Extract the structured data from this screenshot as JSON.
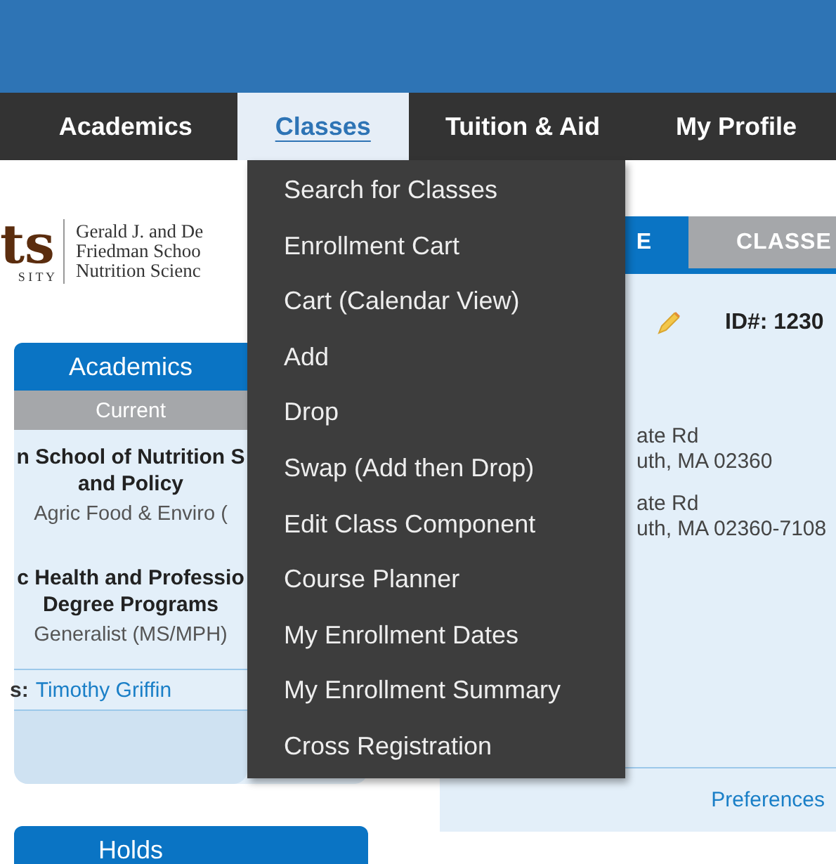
{
  "nav": [
    {
      "label": "Academics",
      "selected": false
    },
    {
      "label": "Classes",
      "selected": true
    },
    {
      "label": "Tuition & Aid",
      "selected": false
    },
    {
      "label": "My Profile",
      "selected": false
    }
  ],
  "dropdown": [
    "Search for Classes",
    "Enrollment Cart",
    "Cart (Calendar View)",
    "Add",
    "Drop",
    "Swap (Add then Drop)",
    "Edit Class Component",
    "Course Planner",
    "My Enrollment Dates",
    "My Enrollment Summary",
    "Cross Registration"
  ],
  "logo": {
    "mark": "ts",
    "mark_sub": "S I T Y",
    "lines": [
      "Gerald J. and De",
      "Friedman Schoo",
      "Nutrition Scienc"
    ]
  },
  "academics_panel": {
    "title": "Academics",
    "subtitle": "Current",
    "programs": [
      {
        "school": "n School of Nutrition S",
        "school_2": "and Policy",
        "plan": "Agric Food & Enviro ("
      },
      {
        "school": "c Health and Professio",
        "school_2": "Degree Programs",
        "plan": "Generalist (MS/MPH)"
      }
    ],
    "advisor_label": "s:",
    "advisor": "Timothy Griffin"
  },
  "holds_panel": {
    "title": "Holds"
  },
  "profile_panel": {
    "tabs": [
      {
        "label": "E",
        "selected": true
      },
      {
        "label": "CLASSE",
        "selected": false
      }
    ],
    "id": "ID#: 1230",
    "addresses": [
      [
        "ate Rd",
        "uth, MA 02360"
      ],
      [
        "ate Rd",
        "uth, MA 02360-7108"
      ]
    ],
    "link": "Preferences"
  }
}
